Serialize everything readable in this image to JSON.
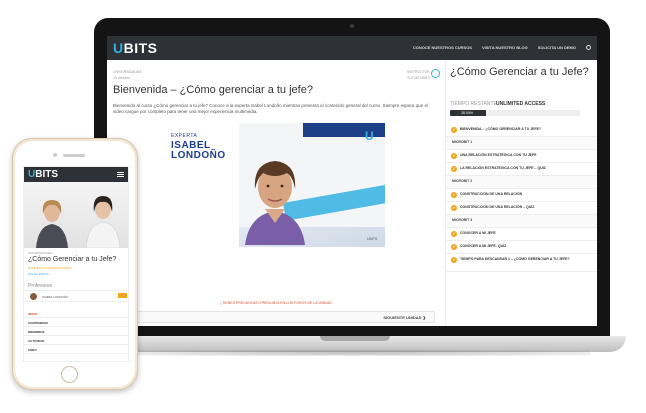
{
  "desktop": {
    "logo": {
      "prefix": "U",
      "rest": "BITS"
    },
    "nav_links": [
      "CONOCE NUESTROS CURSOS",
      "VISITA NUESTRO BLOG",
      "SOLICITA UN DEMO"
    ],
    "meta_left": {
      "category": "UNIVERSIDADES",
      "duration": "15 minutos"
    },
    "meta_right": {
      "role": "INSTRUCTOR",
      "name": "TUTOR UBITS"
    },
    "lesson_title": "Bienvenida – ¿Cómo gerenciar a tu jefe?",
    "lesson_desc": "Bienvenido al curso ¿Cómo gerenciar a tu jefe? Conoce a la experta Isabel Londoño mientras presenta el contenido general del curso. Siempre espera que el video cargue por completo para tener una mejor experiencia multimedia.",
    "video": {
      "label_experta": "EXPERTA",
      "name_line1": "ISABEL",
      "name_line2": "LONDOÑO",
      "brand_mark": "U",
      "brand_small": "UBITS"
    },
    "questions_text": "¿TIENES PREGUNTAS? PREGUNTA EN LOS FOROS DE LA UNIDAD",
    "next_unit": "SIGUIENTE UNIDAD  ❯",
    "sidebar": {
      "title": "¿Cómo Gerenciar a tu Jefe?",
      "time_label": "TIEMPO RESTANTE",
      "access": "UNLIMITED ACCESS",
      "progress_label": "28.00%",
      "progress_fraction": 0.28,
      "items": [
        {
          "type": "lesson",
          "label": "BIENVENIDA – ¿CÓMO GERENCIAR A TU JEFE?"
        },
        {
          "type": "section",
          "label": "MICROBIT 1"
        },
        {
          "type": "lesson",
          "label": "UNA RELACIÓN ESTRATÉGICA CON TU JEFE"
        },
        {
          "type": "lesson",
          "label": "LA RELACIÓN ESTRATÉGICA CON TU JEFE – QUIZ"
        },
        {
          "type": "section",
          "label": "MICROBIT 2"
        },
        {
          "type": "lesson",
          "label": "CONSTRUCCIÓN DE UNA RELACIÓN"
        },
        {
          "type": "lesson",
          "label": "CONSTRUCCIÓN DE UNA RELACIÓN – QUIZ"
        },
        {
          "type": "section",
          "label": "MICROBIT 3"
        },
        {
          "type": "lesson",
          "label": "CONOCER A MI JEFE"
        },
        {
          "type": "lesson",
          "label": "CONOCER A MI JEFE- QUIZ"
        },
        {
          "type": "lesson_tall",
          "label": "TIEMPO PARA DESCANSAR 1 – ¿CÓMO GERENCIAR A TU JEFE?"
        }
      ]
    }
  },
  "mobile": {
    "logo": {
      "prefix": "U",
      "rest": "BITS"
    },
    "breadcrumb": "UNIVERSIDADES",
    "title": "¿Cómo Gerenciar a tu Jefe?",
    "stars": "★★★★★ (0 CALIFICACIONES)",
    "enrolled": "204 ALUMNOS",
    "profesores_label": "Profesores",
    "professor_name": "ISABEL LONDOÑO",
    "tabs": [
      "INICIO",
      "CONTENIDOS",
      "MIEMBROS",
      "ACTIVIDAD",
      "FORO"
    ]
  },
  "colors": {
    "accent": "#33b0e0",
    "orange": "#f2a51f",
    "dark_nav": "#2e3135",
    "brand_blue": "#1c3e87"
  }
}
